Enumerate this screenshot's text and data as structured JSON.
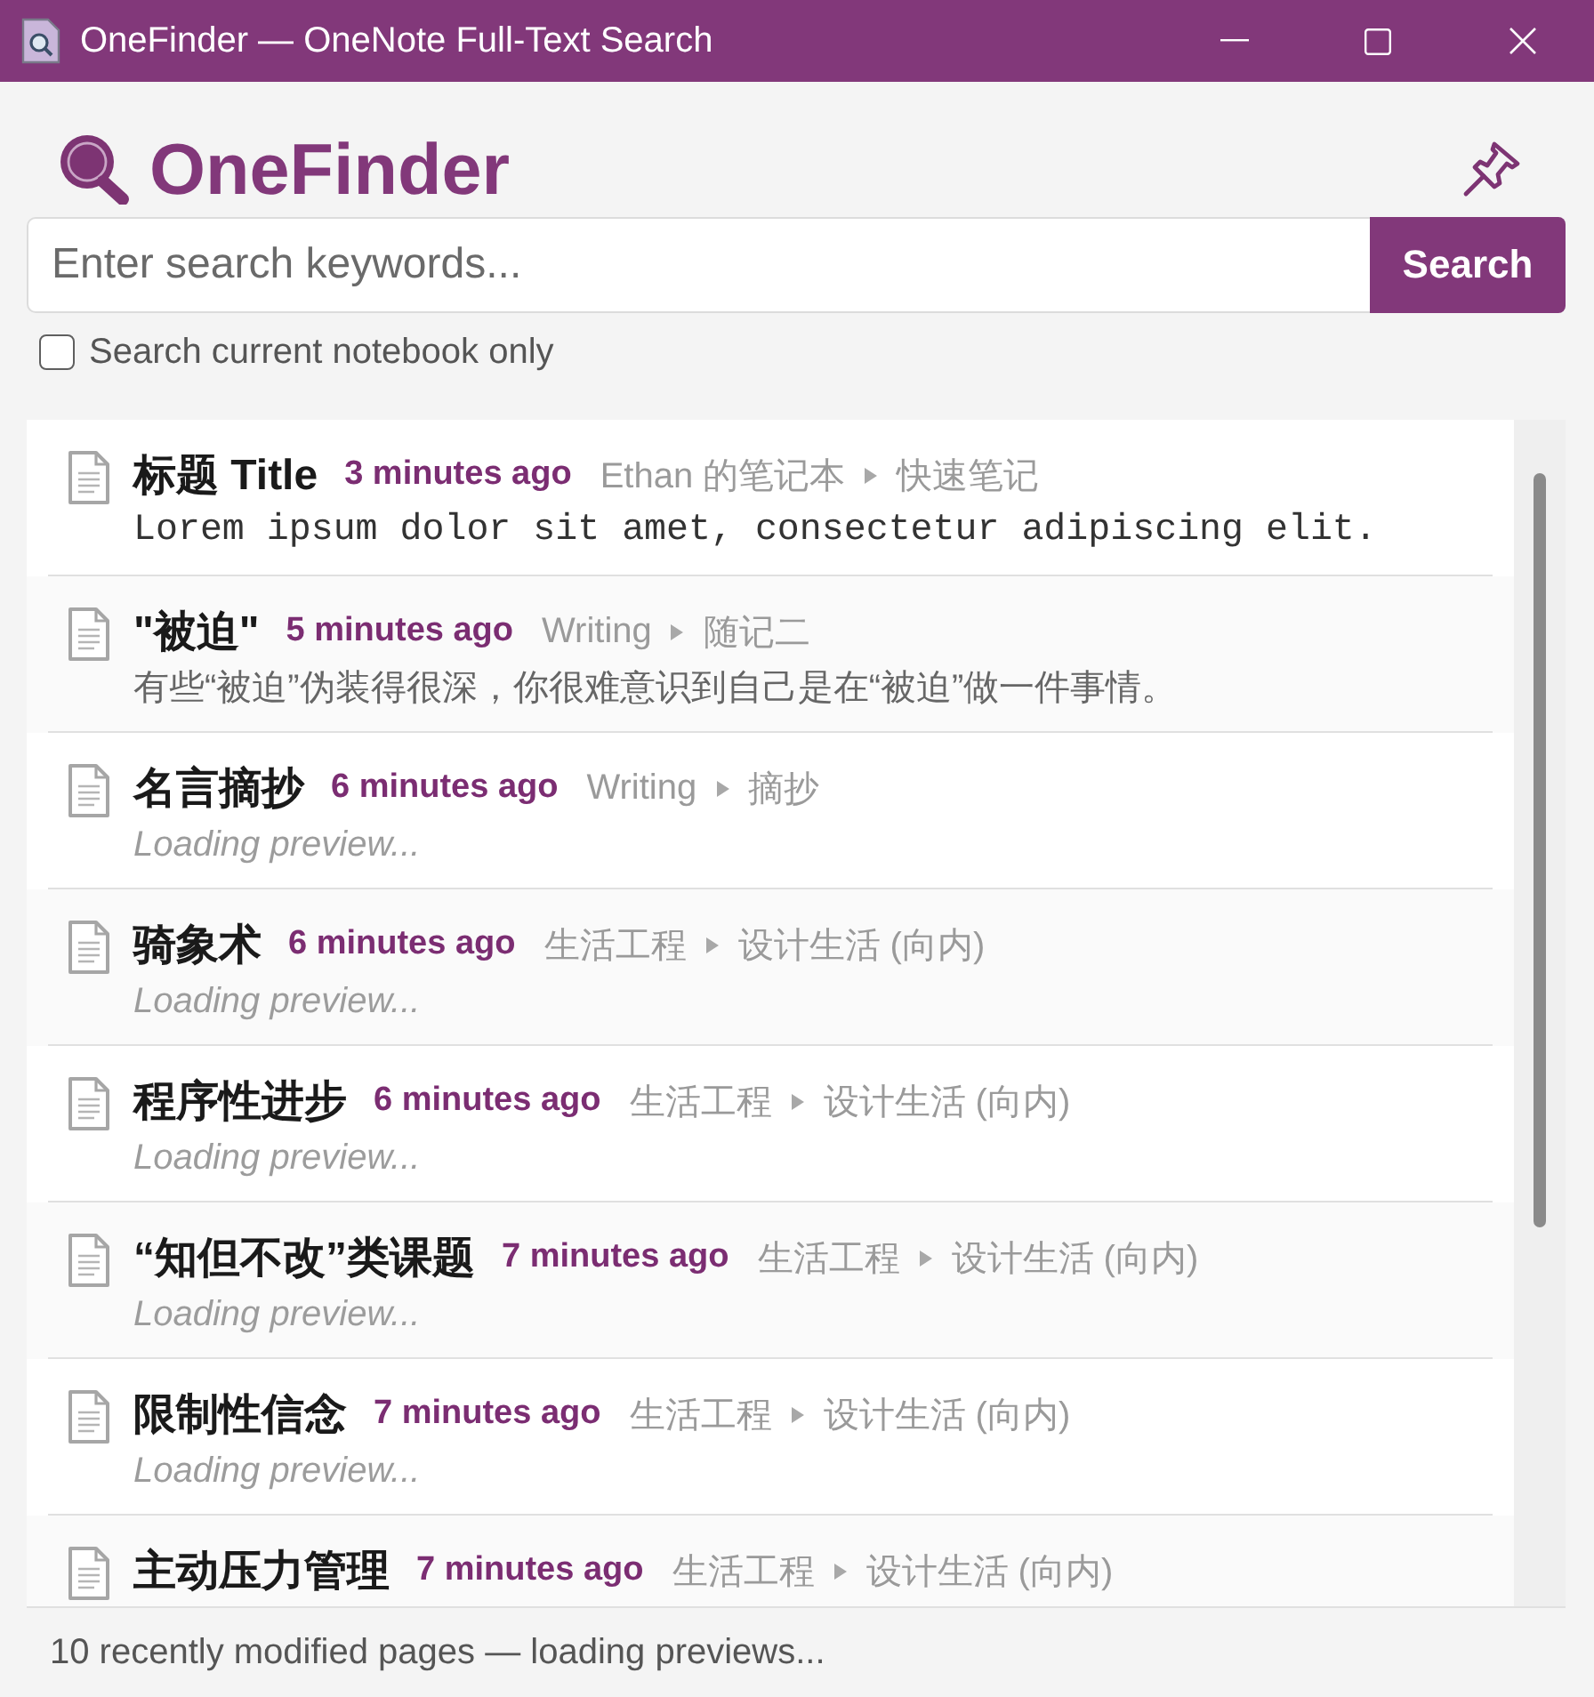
{
  "window": {
    "title": "OneFinder — OneNote Full-Text Search"
  },
  "header": {
    "logo_text": "OneFinder"
  },
  "search": {
    "placeholder": "Enter search keywords...",
    "button": "Search"
  },
  "scope_checkbox": {
    "label": "Search current notebook only",
    "checked": false
  },
  "results": [
    {
      "title": "标题 Title",
      "time": "3 minutes ago",
      "notebook": "Ethan 的笔记本",
      "section": "快速笔记",
      "preview": {
        "kind": "code",
        "text": "Lorem ipsum dolor sit amet, consectetur adipiscing elit."
      }
    },
    {
      "title": "\"被迫\"",
      "time": "5 minutes ago",
      "notebook": "Writing",
      "section": "随记二",
      "preview": {
        "kind": "plain",
        "text": "有些“被迫”伪装得很深，你很难意识到自己是在“被迫”做一件事情。"
      }
    },
    {
      "title": "名言摘抄",
      "time": "6 minutes ago",
      "notebook": "Writing",
      "section": "摘抄",
      "preview": {
        "kind": "loading",
        "text": "Loading preview..."
      }
    },
    {
      "title": "骑象术",
      "time": "6 minutes ago",
      "notebook": "生活工程",
      "section": "设计生活 (向内)",
      "preview": {
        "kind": "loading",
        "text": "Loading preview..."
      }
    },
    {
      "title": "程序性进步",
      "time": "6 minutes ago",
      "notebook": "生活工程",
      "section": "设计生活 (向内)",
      "preview": {
        "kind": "loading",
        "text": "Loading preview..."
      }
    },
    {
      "title": "“知但不改”类课题",
      "time": "7 minutes ago",
      "notebook": "生活工程",
      "section": "设计生活 (向内)",
      "preview": {
        "kind": "loading",
        "text": "Loading preview..."
      }
    },
    {
      "title": "限制性信念",
      "time": "7 minutes ago",
      "notebook": "生活工程",
      "section": "设计生活 (向内)",
      "preview": {
        "kind": "loading",
        "text": "Loading preview..."
      }
    },
    {
      "title": "主动压力管理",
      "time": "7 minutes ago",
      "notebook": "生活工程",
      "section": "设计生活 (向内)"
    }
  ],
  "status_bar": "10 recently modified pages — loading previews..."
}
